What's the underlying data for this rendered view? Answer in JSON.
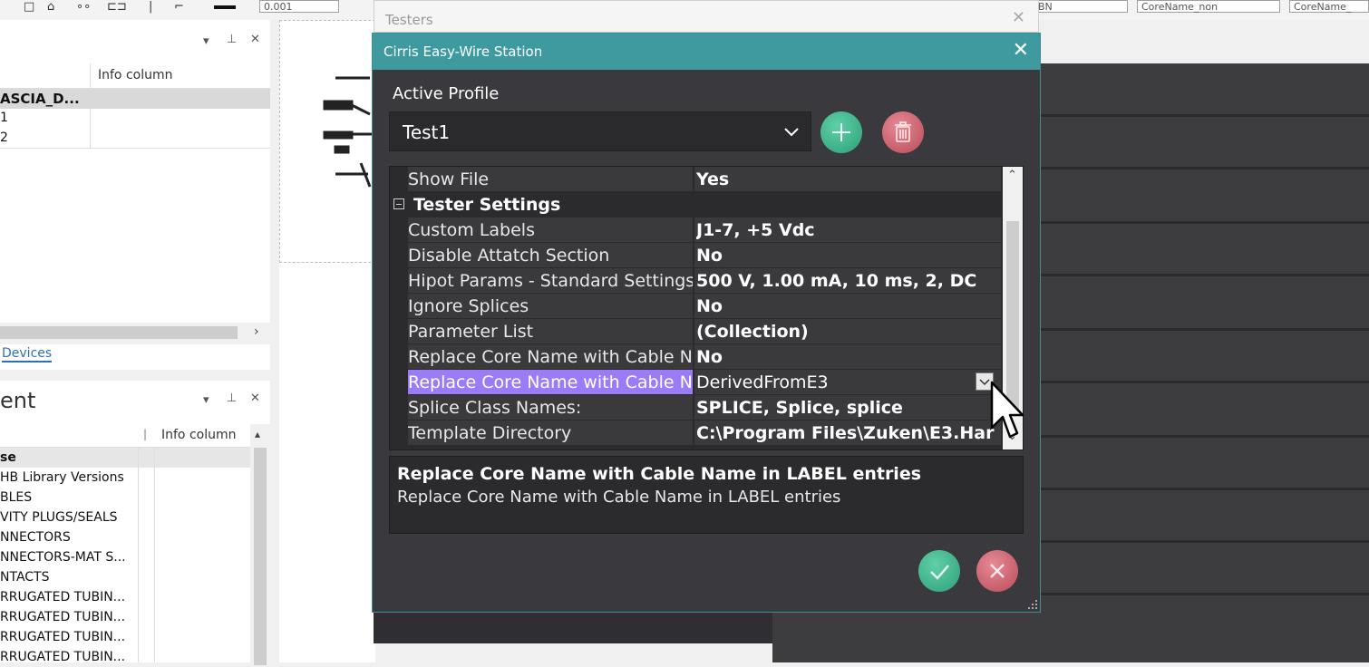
{
  "app": {
    "testers_title": "Testers",
    "dialog_title": "Cirris Easy-Wire Station"
  },
  "toolbar": {
    "combo1": "0.001",
    "combo2": "BN",
    "combo3": "CoreName_non",
    "combo4": "CoreName_"
  },
  "left_top": {
    "column_header": "Info column",
    "rows": [
      "ASCIA_D...",
      "1",
      "2"
    ],
    "tab_label": "Devices"
  },
  "left_bottom": {
    "title": "ent",
    "column_header": "Info column",
    "rows": [
      "se",
      "HB Library Versions",
      "BLES",
      "VITY PLUGS/SEALS",
      "NNECTORS",
      "NNECTORS-MAT S...",
      "NTACTS",
      "RRUGATED TUBIN...",
      "RRUGATED TUBIN...",
      "RRUGATED TUBIN...",
      "RRUGATED TUBIN..."
    ]
  },
  "dialog": {
    "active_profile_label": "Active Profile",
    "profile_value": "Test1",
    "properties": [
      {
        "name": "Show File",
        "value": "Yes"
      },
      {
        "category": "Tester Settings"
      },
      {
        "name": "Custom Labels",
        "value": "J1-7, +5 Vdc"
      },
      {
        "name": "Disable Attatch Section",
        "value": "No"
      },
      {
        "name": "Hipot Params - Standard Settings",
        "value": "500 V,  1.00 mA,  10 ms,  2,  DC"
      },
      {
        "name": "Ignore Splices",
        "value": "No"
      },
      {
        "name": "Parameter List",
        "value": "(Collection)"
      },
      {
        "name": "Replace Core Name with Cable N",
        "value": "No"
      },
      {
        "name": "Replace Core Name with Cable N",
        "value": "DerivedFromE3",
        "selected": true
      },
      {
        "name": "Splice Class Names:",
        "value": "SPLICE, Splice, splice"
      },
      {
        "name": "Template Directory",
        "value": "C:\\Program Files\\Zuken\\E3.Har"
      }
    ],
    "description_title": "Replace Core Name with Cable Name in LABEL entries",
    "description_text": "Replace Core Name with Cable Name in LABEL entries"
  },
  "colors": {
    "titlebar": "#3f9aa0",
    "dialog_bg": "#3a3a3e",
    "selected_name": "#9a7cf6",
    "accept": "#3aaa84",
    "reject": "#c85563"
  },
  "icons": [
    "close-icon",
    "chevron-down-icon",
    "plus-icon",
    "trash-icon",
    "check-icon",
    "x-icon",
    "collapse-minus-icon",
    "scroll-up-icon",
    "scroll-down-icon",
    "resize-grip-icon",
    "pin-icon",
    "dropdown-arrow-icon",
    "mouse-pointer-icon"
  ]
}
